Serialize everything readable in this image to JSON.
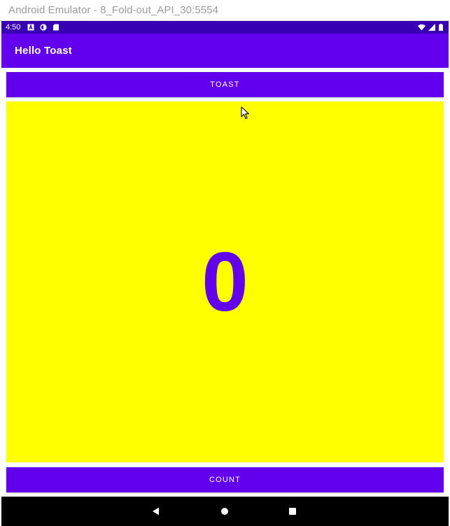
{
  "window": {
    "title": "Android Emulator - 8_Fold-out_API_30:5554"
  },
  "status_bar": {
    "time": "4:50",
    "left_icons": [
      "notification-a-icon",
      "sync-icon",
      "sd-card-icon"
    ],
    "right_icons": [
      "wifi-icon",
      "signal-icon",
      "battery-icon"
    ]
  },
  "app_bar": {
    "title": "Hello Toast"
  },
  "toast_button": {
    "label": "TOAST"
  },
  "count_display": {
    "value": "0"
  },
  "count_button": {
    "label": "COUNT"
  },
  "nav_bar": {
    "buttons": [
      "back-icon",
      "home-icon",
      "recents-icon"
    ]
  },
  "colors": {
    "primary": "#6200ee",
    "primary_dark": "#3700b3",
    "panel": "#ffff00",
    "nav": "#000000"
  }
}
